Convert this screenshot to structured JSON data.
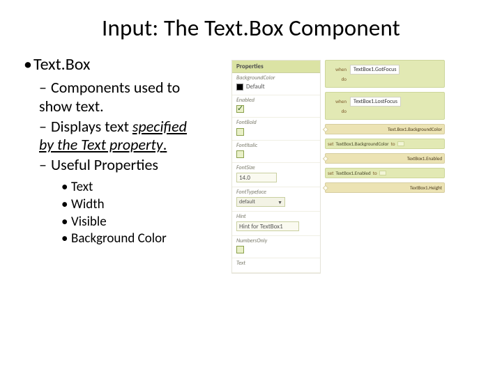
{
  "title": "Input: The Text.Box Component",
  "bullets": {
    "lvl1": "Text.Box",
    "sub1a": "Components used to",
    "sub1b": "show text.",
    "sub2a": "Displays text ",
    "sub2b_ital": "specified",
    "sub2c_ital": "by the Text property",
    "sub2d": ".",
    "sub3": "Useful Properties",
    "props": [
      "Text",
      "Width",
      "Visible",
      "Background Color"
    ]
  },
  "propsPanel": {
    "header": "Properties",
    "rows": {
      "bgcolor": {
        "label": "BackgroundColor",
        "value": "Default"
      },
      "enabled": {
        "label": "Enabled"
      },
      "fontbold": {
        "label": "FontBold"
      },
      "fontitalic": {
        "label": "FontItalic"
      },
      "fontsize": {
        "label": "FontSize",
        "value": "14.0"
      },
      "fonttypeface": {
        "label": "FontTypeface",
        "value": "default"
      },
      "hint": {
        "label": "Hint",
        "value": "Hint for TextBox1"
      },
      "numbersonly": {
        "label": "NumbersOnly"
      },
      "text": {
        "label": "Text"
      }
    }
  },
  "blocks": {
    "event1": {
      "when": "when",
      "do": "do",
      "name": "TextBox1.GotFocus"
    },
    "event2": {
      "when": "when",
      "do": "do",
      "name": "TextBox1.LostFocus"
    },
    "get1": "Text.Box1.BackgroundColor",
    "set1": {
      "set": "set",
      "to": "to",
      "name": "TextBox1.BackgroundColor"
    },
    "get2": "TextBox1.Enabled",
    "set2": {
      "set": "set",
      "to": "to",
      "name": "TextBox1.Enabled"
    },
    "get3": "TextBox1.Height"
  }
}
